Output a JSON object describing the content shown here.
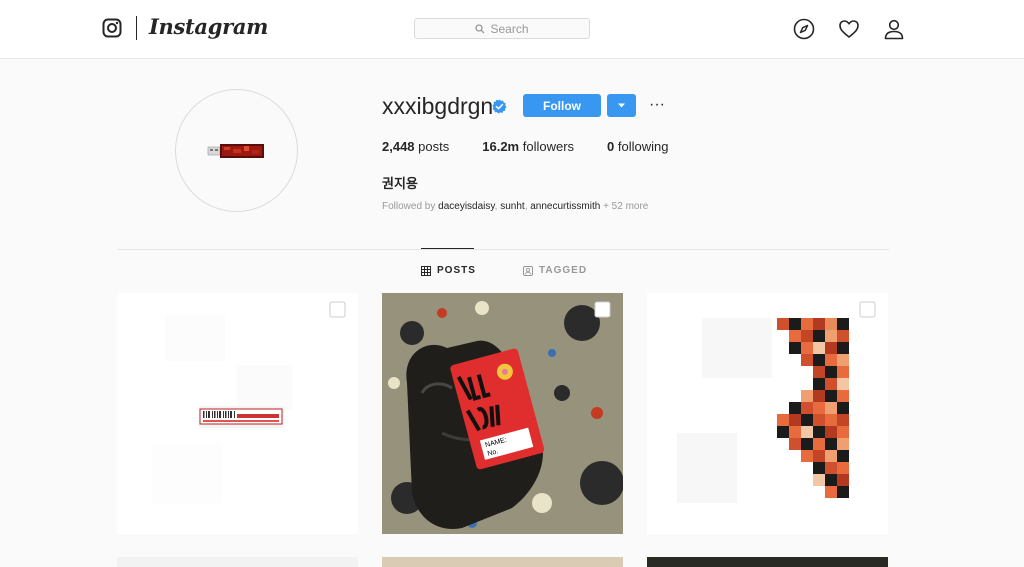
{
  "header": {
    "brand": "Instagram",
    "search_placeholder": "Search",
    "icons": [
      "instagram-logo-icon",
      "explore-compass-icon",
      "heart-icon",
      "profile-user-icon"
    ]
  },
  "profile": {
    "username": "xxxibgdrgn",
    "verified": true,
    "follow_label": "Follow",
    "more_label": "···",
    "stats": {
      "posts_count": "2,448",
      "posts_label": "posts",
      "followers_count": "16.2m",
      "followers_label": "followers",
      "following_count": "0",
      "following_label": "following"
    },
    "full_name": "권지용",
    "followed_by": {
      "prefix": "Followed by",
      "users": [
        "daceyisdaisy",
        "sunht",
        "annecurtissmith"
      ],
      "separator": ", ",
      "more": "+ 52 more"
    }
  },
  "tabs": [
    {
      "label": "POSTS",
      "active": true
    },
    {
      "label": "TAGGED",
      "active": false
    }
  ],
  "colors": {
    "accent": "#3897f0",
    "background": "#fafafa",
    "text": "#262626",
    "muted": "#999999",
    "verified": "#3897f0"
  }
}
